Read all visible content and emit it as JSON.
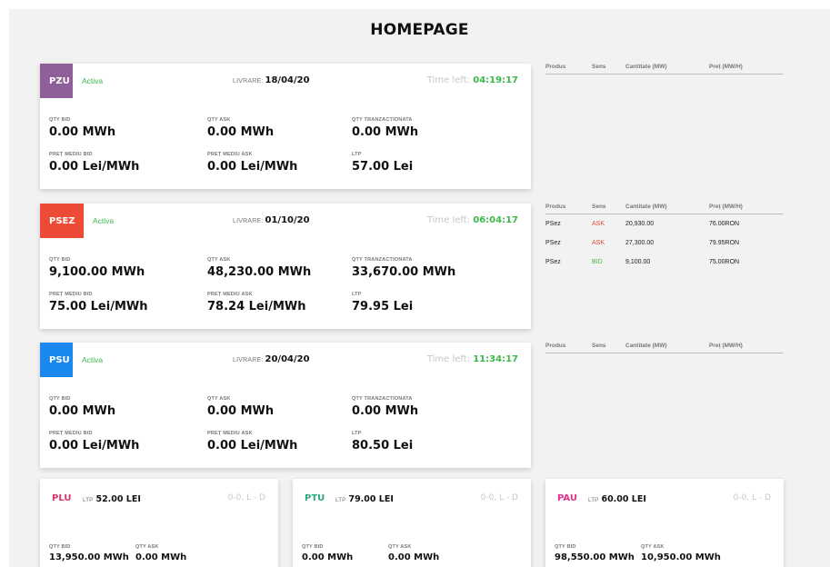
{
  "page_title": "HOMEPAGE",
  "markets": [
    {
      "tag": "PZU",
      "tag_color": "#8f5f9a",
      "status": "Activa",
      "delivery_label": "LIVRARE:",
      "delivery_date": "18/04/20",
      "time_left_label": "Time left:",
      "time_left": "04:19:17",
      "qty_bid_label": "QTY BID",
      "qty_bid": "0.00 MWh",
      "qty_ask_label": "QTY ASK",
      "qty_ask": "0.00 MWh",
      "qty_traded_label": "QTY TRANZACTIONATA",
      "qty_traded": "0.00 MWh",
      "avg_bid_label": "PREȚ MEDIU BID",
      "avg_bid": "0.00 Lei/MWh",
      "avg_ask_label": "PREȚ MEDIU ASK",
      "avg_ask": "0.00 Lei/MWh",
      "ltp_label": "LTP",
      "ltp": "57.00 Lei",
      "orders": []
    },
    {
      "tag": "PSEZ",
      "tag_color": "#ee4b36",
      "status": "Activa",
      "delivery_label": "LIVRARE:",
      "delivery_date": "01/10/20",
      "time_left_label": "Time left:",
      "time_left": "06:04:17",
      "qty_bid_label": "QTY BID",
      "qty_bid": "9,100.00 MWh",
      "qty_ask_label": "QTY ASK",
      "qty_ask": "48,230.00 MWh",
      "qty_traded_label": "QTY TRANZACTIONATA",
      "qty_traded": "33,670.00 MWh",
      "avg_bid_label": "PREȚ MEDIU BID",
      "avg_bid": "75.00 Lei/MWh",
      "avg_ask_label": "PREȚ MEDIU ASK",
      "avg_ask": "78.24 Lei/MWh",
      "ltp_label": "LTP",
      "ltp": "79.95 Lei",
      "orders": [
        {
          "product": "PSez",
          "side": "ASK",
          "qty": "20,930.00",
          "price": "76.00RON"
        },
        {
          "product": "PSez",
          "side": "ASK",
          "qty": "27,300.00",
          "price": "79.95RON"
        },
        {
          "product": "PSez",
          "side": "BID",
          "qty": "9,100.00",
          "price": "75.00RON"
        }
      ]
    },
    {
      "tag": "PSU",
      "tag_color": "#1a88f0",
      "status": "Activa",
      "delivery_label": "LIVRARE:",
      "delivery_date": "20/04/20",
      "time_left_label": "Time left:",
      "time_left": "11:34:17",
      "qty_bid_label": "QTY BID",
      "qty_bid": "0.00 MWh",
      "qty_ask_label": "QTY ASK",
      "qty_ask": "0.00 MWh",
      "qty_traded_label": "QTY TRANZACTIONATA",
      "qty_traded": "0.00 MWh",
      "avg_bid_label": "PREȚ MEDIU BID",
      "avg_bid": "0.00 Lei/MWh",
      "avg_ask_label": "PREȚ MEDIU ASK",
      "avg_ask": "0.00 Lei/MWh",
      "ltp_label": "LTP",
      "ltp": "80.50 Lei",
      "orders": []
    }
  ],
  "order_table_headers": {
    "product": "Produs",
    "side": "Sens",
    "qty": "Cantitate (MW)",
    "price": "Preț (MW/H)"
  },
  "side_colors": {
    "ASK": "#e34b3b",
    "BID": "#3cb84a"
  },
  "small_markets": [
    {
      "name": "PLU",
      "name_color": "#d8336b",
      "ltp_label": "LTP",
      "ltp": "52.00 LEI",
      "score": "0-0, L - D",
      "qty_bid_label": "QTY BID",
      "qty_bid": "13,950.00 MWh",
      "qty_ask_label": "QTY ASK",
      "qty_ask": "0.00 MWh"
    },
    {
      "name": "PTU",
      "name_color": "#2ea87a",
      "ltp_label": "LTP",
      "ltp": "79.00 LEI",
      "score": "0-0, L - D",
      "qty_bid_label": "QTY BID",
      "qty_bid": "0.00 MWh",
      "qty_ask_label": "QTY ASK",
      "qty_ask": "0.00 MWh"
    },
    {
      "name": "PAU",
      "name_color": "#e0318f",
      "ltp_label": "LTP",
      "ltp": "60.00 LEI",
      "score": "0-0, L - D",
      "qty_bid_label": "QTY BID",
      "qty_bid": "98,550.00 MWh",
      "qty_ask_label": "QTY ASK",
      "qty_ask": "10,950.00 MWh"
    }
  ]
}
